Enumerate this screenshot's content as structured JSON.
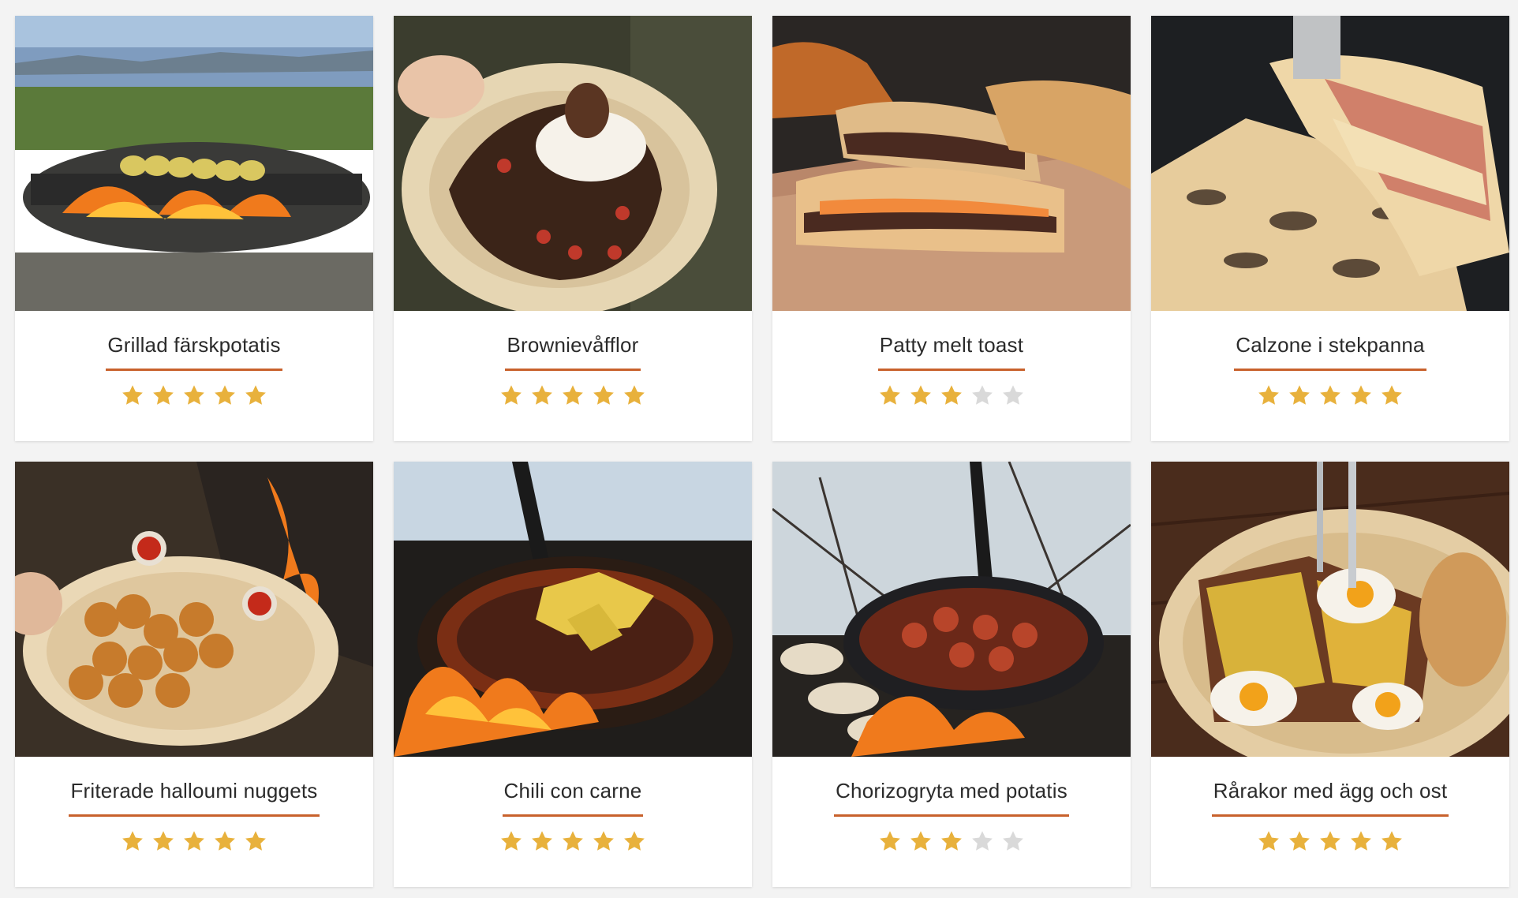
{
  "colors": {
    "accent_underline": "#c8612c",
    "star_filled": "#e8b13c",
    "star_empty": "#d9d9d9",
    "background": "#f3f3f3",
    "card": "#ffffff",
    "title_text": "#2b2b2b"
  },
  "recipes": [
    {
      "title": "Grillad färskpotatis",
      "rating": 5,
      "max_rating": 5,
      "image": "grilled-potato-skewers-photo"
    },
    {
      "title": "Brownievåfflor",
      "rating": 5,
      "max_rating": 5,
      "image": "brownie-waffles-photo"
    },
    {
      "title": "Patty melt toast",
      "rating": 3,
      "max_rating": 5,
      "image": "patty-melt-toast-photo"
    },
    {
      "title": "Calzone i stekpanna",
      "rating": 5,
      "max_rating": 5,
      "image": "calzone-pan-photo"
    },
    {
      "title": "Friterade halloumi nuggets",
      "rating": 5,
      "max_rating": 5,
      "image": "halloumi-nuggets-photo"
    },
    {
      "title": "Chili con carne",
      "rating": 5,
      "max_rating": 5,
      "image": "chili-con-carne-photo"
    },
    {
      "title": "Chorizogryta med potatis",
      "rating": 3,
      "max_rating": 5,
      "image": "chorizo-stew-photo"
    },
    {
      "title": "Rårakor med ägg och ost",
      "rating": 5,
      "max_rating": 5,
      "image": "potato-pancakes-egg-cheese-photo"
    }
  ]
}
